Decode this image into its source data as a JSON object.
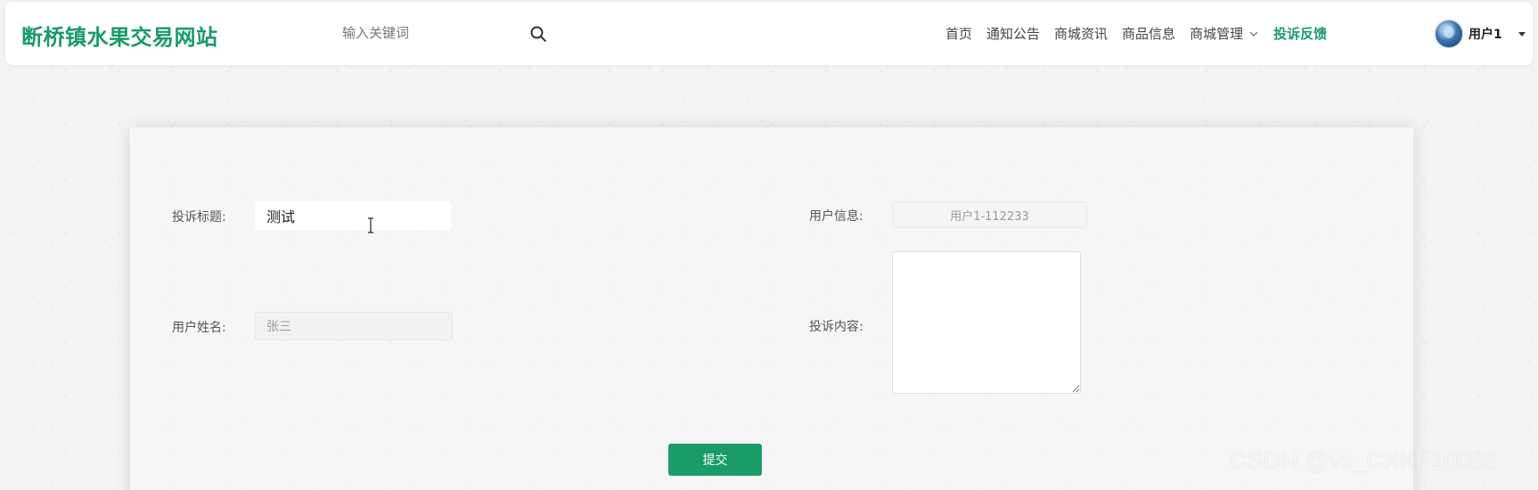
{
  "header": {
    "brand": "断桥镇水果交易网站",
    "search": {
      "placeholder": "输入关键词",
      "value": ""
    },
    "nav": [
      {
        "label": "首页"
      },
      {
        "label": "通知公告"
      },
      {
        "label": "商城资讯"
      },
      {
        "label": "商品信息"
      },
      {
        "label": "商城管理",
        "has_dropdown": true
      },
      {
        "label": "投诉反馈",
        "active": true
      }
    ],
    "user": {
      "name": "用户1"
    }
  },
  "form": {
    "title_label": "投诉标题:",
    "title_value": "测试",
    "username_label": "用户姓名:",
    "username_value": "张三",
    "userinfo_label": "用户信息:",
    "userinfo_value": "用户1-112233",
    "content_label": "投诉内容:",
    "content_value": "",
    "submit_label": "提交"
  },
  "watermark": "CSDN @vx_CXKF10088",
  "colors": {
    "brand": "#1a9b68",
    "active_nav": "#1a9b68",
    "button": "#1a9b68",
    "page_bg": "#f3f3f3"
  },
  "icons": {
    "search": "search-icon",
    "dropdown": "chevron-down-icon",
    "user_menu": "caret-down-icon",
    "cursor": "text-cursor-icon"
  }
}
